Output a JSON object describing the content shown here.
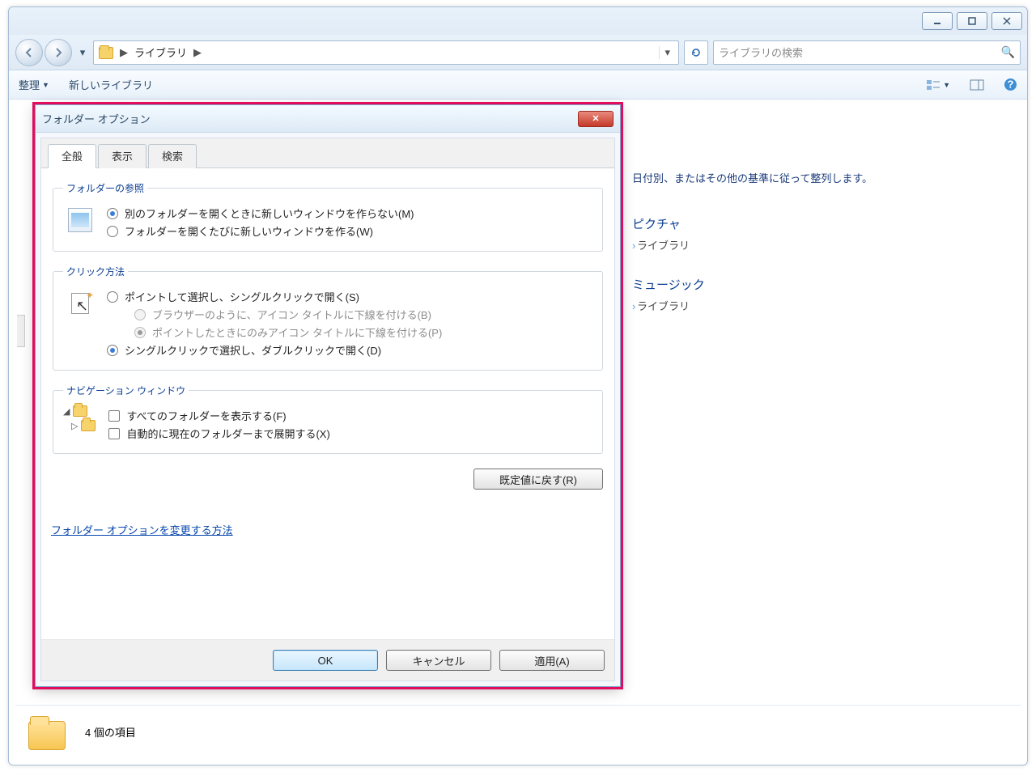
{
  "window": {
    "breadcrumb_root": "ライブラリ",
    "search_placeholder": "ライブラリの検索"
  },
  "toolbar": {
    "organize": "整理",
    "new_library": "新しいライブラリ"
  },
  "pane": {
    "sort_hint": "日付別、またはその他の基準に従って整列します。",
    "items": [
      {
        "title": "ピクチャ",
        "subtitle": "ライブラリ"
      },
      {
        "title": "ミュージック",
        "subtitle": "ライブラリ"
      }
    ]
  },
  "status": {
    "text": "4 個の項目"
  },
  "dialog": {
    "title": "フォルダー オプション",
    "tabs": {
      "general": "全般",
      "view": "表示",
      "search": "検索"
    },
    "browse": {
      "legend": "フォルダーの参照",
      "opt_same": "別のフォルダーを開くときに新しいウィンドウを作らない(M)",
      "opt_new": "フォルダーを開くたびに新しいウィンドウを作る(W)"
    },
    "click": {
      "legend": "クリック方法",
      "opt_single": "ポイントして選択し、シングルクリックで開く(S)",
      "opt_single_a": "ブラウザーのように、アイコン タイトルに下線を付ける(B)",
      "opt_single_b": "ポイントしたときにのみアイコン タイトルに下線を付ける(P)",
      "opt_double": "シングルクリックで選択し、ダブルクリックで開く(D)"
    },
    "nav": {
      "legend": "ナビゲーション ウィンドウ",
      "opt_all": "すべてのフォルダーを表示する(F)",
      "opt_expand": "自動的に現在のフォルダーまで展開する(X)"
    },
    "reset": "既定値に戻す(R)",
    "help_link": "フォルダー オプションを変更する方法",
    "ok": "OK",
    "cancel": "キャンセル",
    "apply": "適用(A)"
  }
}
